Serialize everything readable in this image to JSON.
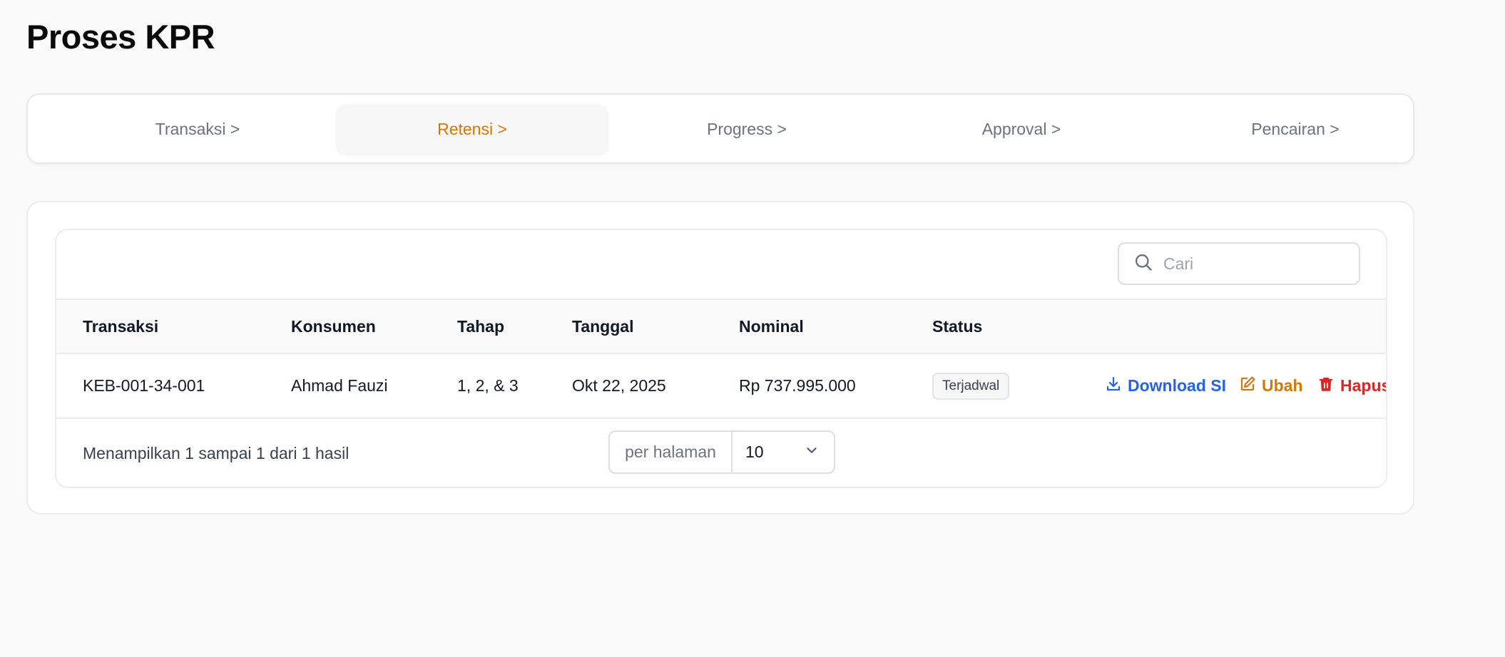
{
  "page": {
    "title": "Proses KPR"
  },
  "tabs": [
    {
      "label": "Transaksi >",
      "active": false
    },
    {
      "label": "Retensi >",
      "active": true
    },
    {
      "label": "Progress >",
      "active": false
    },
    {
      "label": "Approval >",
      "active": false
    },
    {
      "label": "Pencairan >",
      "active": false
    }
  ],
  "search": {
    "placeholder": "Cari",
    "icon": "search-icon"
  },
  "table": {
    "columns": [
      "Transaksi",
      "Konsumen",
      "Tahap",
      "Tanggal",
      "Nominal",
      "Status"
    ],
    "rows": [
      {
        "transaksi": "KEB-001-34-001",
        "konsumen": "Ahmad Fauzi",
        "tahap": "1, 2, & 3",
        "tanggal": "Okt 22, 2025",
        "nominal": "Rp 737.995.000",
        "status": "Terjadwal",
        "actions": {
          "download": "Download SI",
          "edit": "Ubah",
          "delete": "Hapus"
        }
      }
    ]
  },
  "footer": {
    "summary": "Menampilkan 1 sampai 1 dari 1 hasil",
    "per_page_label": "per halaman",
    "per_page_value": "10"
  },
  "colors": {
    "accent": "#d97706",
    "download": "#2563eb",
    "edit": "#d97706",
    "delete": "#dc2626"
  }
}
